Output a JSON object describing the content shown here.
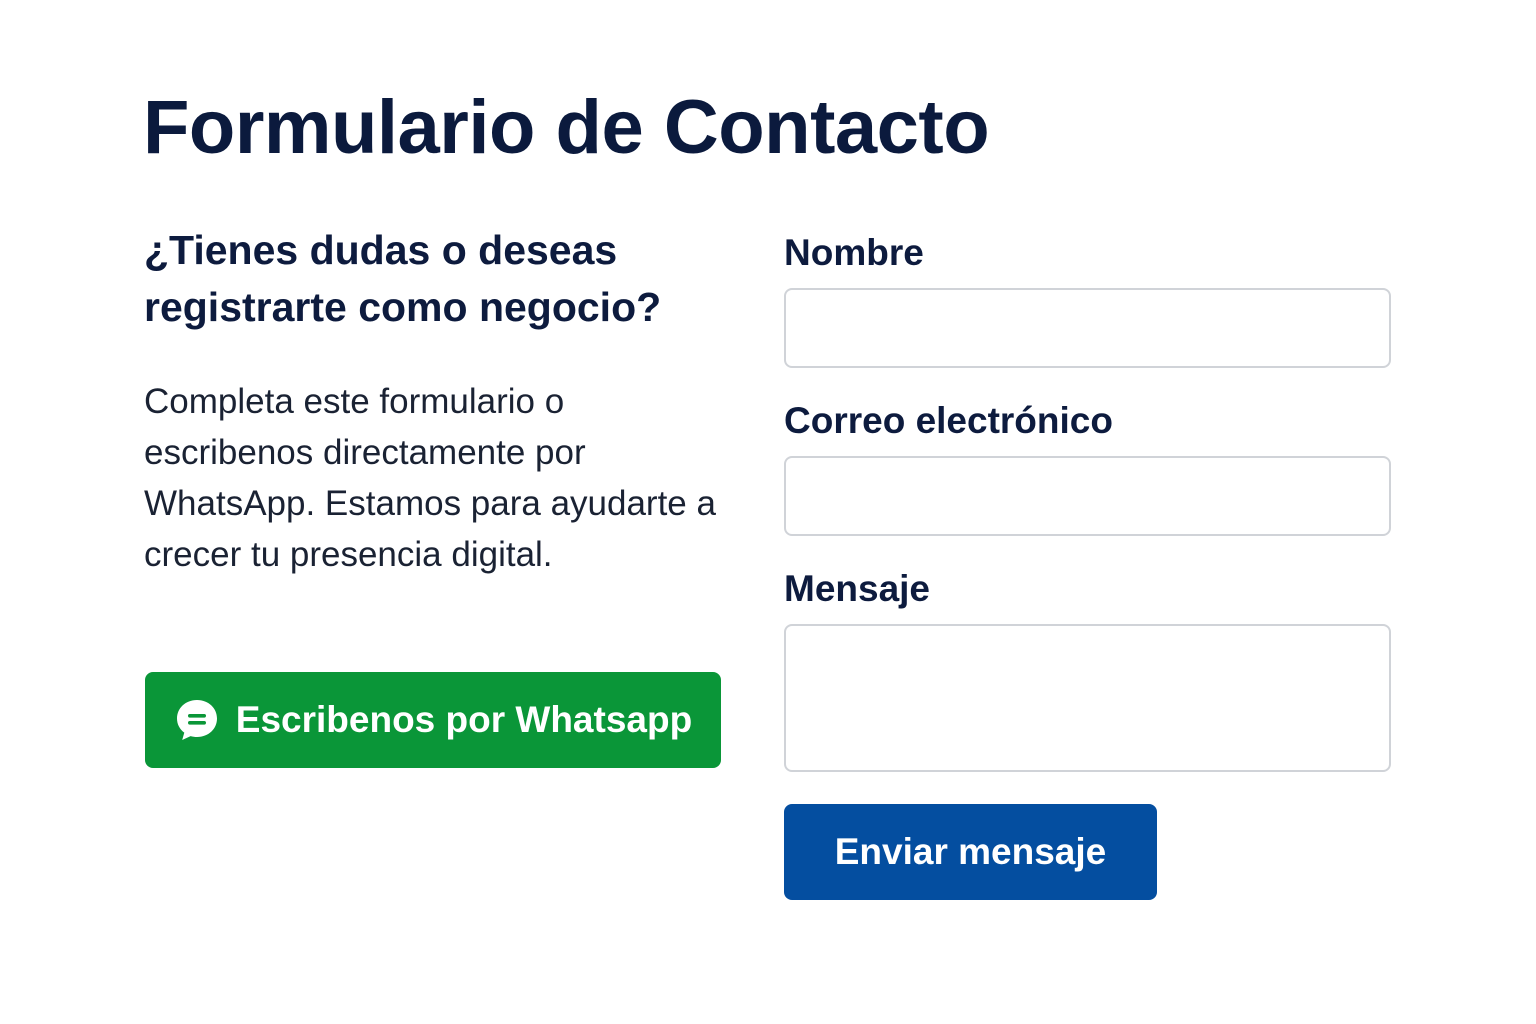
{
  "header": {
    "title": "Formulario de Contacto"
  },
  "intro": {
    "heading": "¿Tienes dudas o deseas registrarte como negocio?",
    "description": "Completa este formulario o escribenos directamente por WhatsApp. Estamos para ayudarte a crecer tu presencia digital."
  },
  "whatsapp": {
    "label": "Escribenos por Whatsapp",
    "icon": "chat-bubble-icon",
    "color": "#0a9638"
  },
  "form": {
    "name_label": "Nombre",
    "name_value": "",
    "email_label": "Correo electrónico",
    "email_value": "",
    "message_label": "Mensaje",
    "message_value": "",
    "submit_label": "Enviar mensaje",
    "submit_color": "#044ea0"
  }
}
